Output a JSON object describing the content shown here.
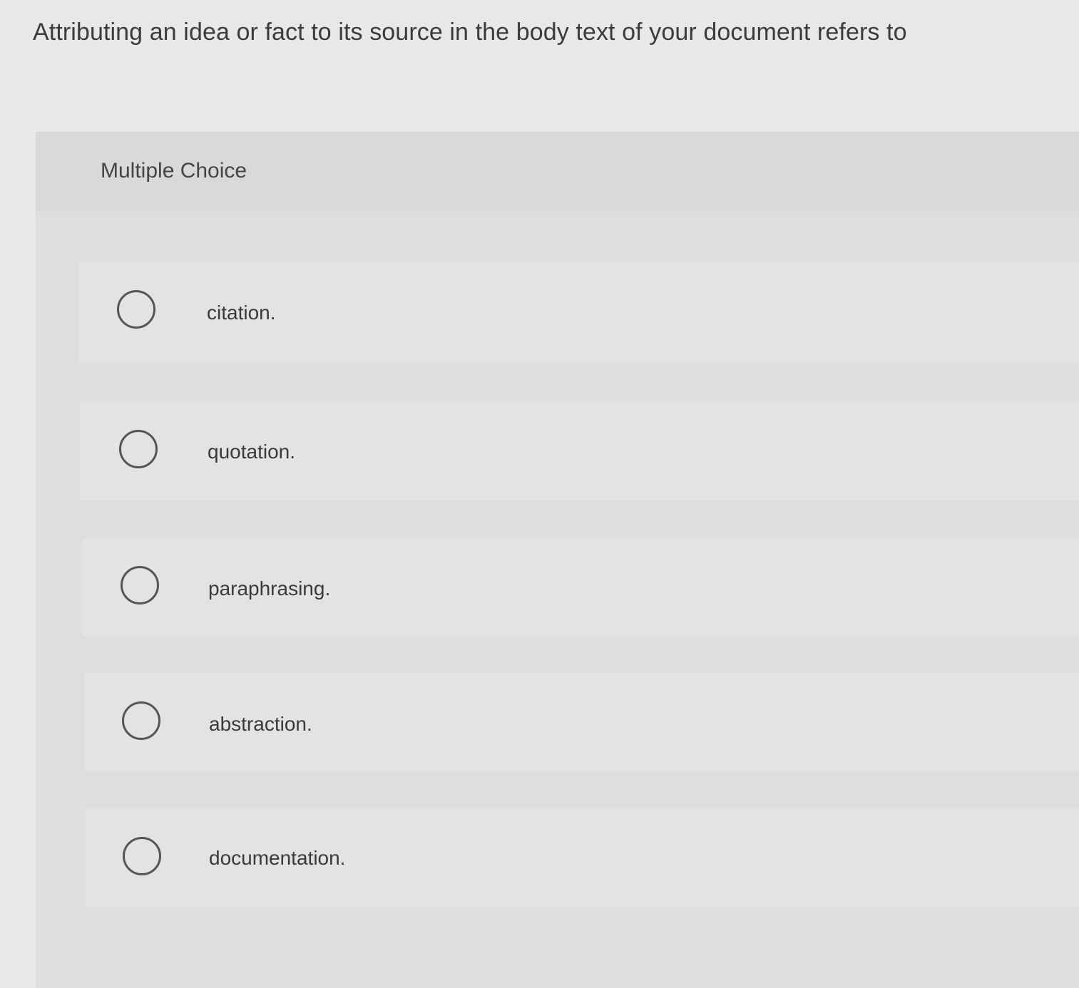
{
  "question": {
    "text": "Attributing an idea or fact to its source in the body text of your document refers to"
  },
  "panel": {
    "title": "Multiple Choice"
  },
  "options": [
    {
      "label": "citation.",
      "selected": false
    },
    {
      "label": "quotation.",
      "selected": false
    },
    {
      "label": "paraphrasing.",
      "selected": false
    },
    {
      "label": "abstraction.",
      "selected": false
    },
    {
      "label": "documentation.",
      "selected": false
    }
  ],
  "colors": {
    "background": "#e8e8e6",
    "panel": "#dededc",
    "option_row": "#e3e3e1",
    "radio_border": "#555555",
    "text": "#3a3a3a"
  }
}
